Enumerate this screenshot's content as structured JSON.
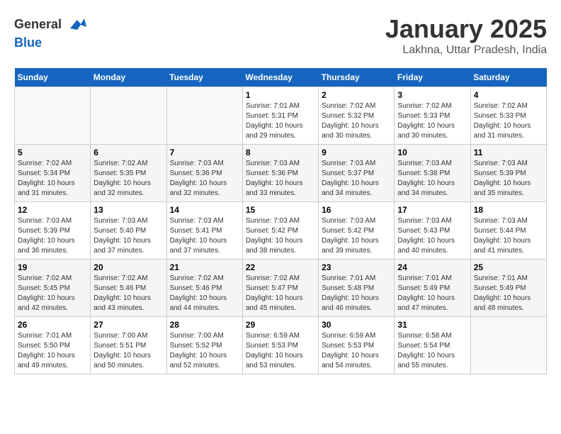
{
  "header": {
    "logo_line1": "General",
    "logo_line2": "Blue",
    "title": "January 2025",
    "subtitle": "Lakhna, Uttar Pradesh, India"
  },
  "weekdays": [
    "Sunday",
    "Monday",
    "Tuesday",
    "Wednesday",
    "Thursday",
    "Friday",
    "Saturday"
  ],
  "weeks": [
    [
      {
        "day": "",
        "sunrise": "",
        "sunset": "",
        "daylight": ""
      },
      {
        "day": "",
        "sunrise": "",
        "sunset": "",
        "daylight": ""
      },
      {
        "day": "",
        "sunrise": "",
        "sunset": "",
        "daylight": ""
      },
      {
        "day": "1",
        "sunrise": "Sunrise: 7:01 AM",
        "sunset": "Sunset: 5:31 PM",
        "daylight": "Daylight: 10 hours and 29 minutes."
      },
      {
        "day": "2",
        "sunrise": "Sunrise: 7:02 AM",
        "sunset": "Sunset: 5:32 PM",
        "daylight": "Daylight: 10 hours and 30 minutes."
      },
      {
        "day": "3",
        "sunrise": "Sunrise: 7:02 AM",
        "sunset": "Sunset: 5:33 PM",
        "daylight": "Daylight: 10 hours and 30 minutes."
      },
      {
        "day": "4",
        "sunrise": "Sunrise: 7:02 AM",
        "sunset": "Sunset: 5:33 PM",
        "daylight": "Daylight: 10 hours and 31 minutes."
      }
    ],
    [
      {
        "day": "5",
        "sunrise": "Sunrise: 7:02 AM",
        "sunset": "Sunset: 5:34 PM",
        "daylight": "Daylight: 10 hours and 31 minutes."
      },
      {
        "day": "6",
        "sunrise": "Sunrise: 7:02 AM",
        "sunset": "Sunset: 5:35 PM",
        "daylight": "Daylight: 10 hours and 32 minutes."
      },
      {
        "day": "7",
        "sunrise": "Sunrise: 7:03 AM",
        "sunset": "Sunset: 5:36 PM",
        "daylight": "Daylight: 10 hours and 32 minutes."
      },
      {
        "day": "8",
        "sunrise": "Sunrise: 7:03 AM",
        "sunset": "Sunset: 5:36 PM",
        "daylight": "Daylight: 10 hours and 33 minutes."
      },
      {
        "day": "9",
        "sunrise": "Sunrise: 7:03 AM",
        "sunset": "Sunset: 5:37 PM",
        "daylight": "Daylight: 10 hours and 34 minutes."
      },
      {
        "day": "10",
        "sunrise": "Sunrise: 7:03 AM",
        "sunset": "Sunset: 5:38 PM",
        "daylight": "Daylight: 10 hours and 34 minutes."
      },
      {
        "day": "11",
        "sunrise": "Sunrise: 7:03 AM",
        "sunset": "Sunset: 5:39 PM",
        "daylight": "Daylight: 10 hours and 35 minutes."
      }
    ],
    [
      {
        "day": "12",
        "sunrise": "Sunrise: 7:03 AM",
        "sunset": "Sunset: 5:39 PM",
        "daylight": "Daylight: 10 hours and 36 minutes."
      },
      {
        "day": "13",
        "sunrise": "Sunrise: 7:03 AM",
        "sunset": "Sunset: 5:40 PM",
        "daylight": "Daylight: 10 hours and 37 minutes."
      },
      {
        "day": "14",
        "sunrise": "Sunrise: 7:03 AM",
        "sunset": "Sunset: 5:41 PM",
        "daylight": "Daylight: 10 hours and 37 minutes."
      },
      {
        "day": "15",
        "sunrise": "Sunrise: 7:03 AM",
        "sunset": "Sunset: 5:42 PM",
        "daylight": "Daylight: 10 hours and 38 minutes."
      },
      {
        "day": "16",
        "sunrise": "Sunrise: 7:03 AM",
        "sunset": "Sunset: 5:42 PM",
        "daylight": "Daylight: 10 hours and 39 minutes."
      },
      {
        "day": "17",
        "sunrise": "Sunrise: 7:03 AM",
        "sunset": "Sunset: 5:43 PM",
        "daylight": "Daylight: 10 hours and 40 minutes."
      },
      {
        "day": "18",
        "sunrise": "Sunrise: 7:03 AM",
        "sunset": "Sunset: 5:44 PM",
        "daylight": "Daylight: 10 hours and 41 minutes."
      }
    ],
    [
      {
        "day": "19",
        "sunrise": "Sunrise: 7:02 AM",
        "sunset": "Sunset: 5:45 PM",
        "daylight": "Daylight: 10 hours and 42 minutes."
      },
      {
        "day": "20",
        "sunrise": "Sunrise: 7:02 AM",
        "sunset": "Sunset: 5:46 PM",
        "daylight": "Daylight: 10 hours and 43 minutes."
      },
      {
        "day": "21",
        "sunrise": "Sunrise: 7:02 AM",
        "sunset": "Sunset: 5:46 PM",
        "daylight": "Daylight: 10 hours and 44 minutes."
      },
      {
        "day": "22",
        "sunrise": "Sunrise: 7:02 AM",
        "sunset": "Sunset: 5:47 PM",
        "daylight": "Daylight: 10 hours and 45 minutes."
      },
      {
        "day": "23",
        "sunrise": "Sunrise: 7:01 AM",
        "sunset": "Sunset: 5:48 PM",
        "daylight": "Daylight: 10 hours and 46 minutes."
      },
      {
        "day": "24",
        "sunrise": "Sunrise: 7:01 AM",
        "sunset": "Sunset: 5:49 PM",
        "daylight": "Daylight: 10 hours and 47 minutes."
      },
      {
        "day": "25",
        "sunrise": "Sunrise: 7:01 AM",
        "sunset": "Sunset: 5:49 PM",
        "daylight": "Daylight: 10 hours and 48 minutes."
      }
    ],
    [
      {
        "day": "26",
        "sunrise": "Sunrise: 7:01 AM",
        "sunset": "Sunset: 5:50 PM",
        "daylight": "Daylight: 10 hours and 49 minutes."
      },
      {
        "day": "27",
        "sunrise": "Sunrise: 7:00 AM",
        "sunset": "Sunset: 5:51 PM",
        "daylight": "Daylight: 10 hours and 50 minutes."
      },
      {
        "day": "28",
        "sunrise": "Sunrise: 7:00 AM",
        "sunset": "Sunset: 5:52 PM",
        "daylight": "Daylight: 10 hours and 52 minutes."
      },
      {
        "day": "29",
        "sunrise": "Sunrise: 6:59 AM",
        "sunset": "Sunset: 5:53 PM",
        "daylight": "Daylight: 10 hours and 53 minutes."
      },
      {
        "day": "30",
        "sunrise": "Sunrise: 6:59 AM",
        "sunset": "Sunset: 5:53 PM",
        "daylight": "Daylight: 10 hours and 54 minutes."
      },
      {
        "day": "31",
        "sunrise": "Sunrise: 6:58 AM",
        "sunset": "Sunset: 5:54 PM",
        "daylight": "Daylight: 10 hours and 55 minutes."
      },
      {
        "day": "",
        "sunrise": "",
        "sunset": "",
        "daylight": ""
      }
    ]
  ]
}
